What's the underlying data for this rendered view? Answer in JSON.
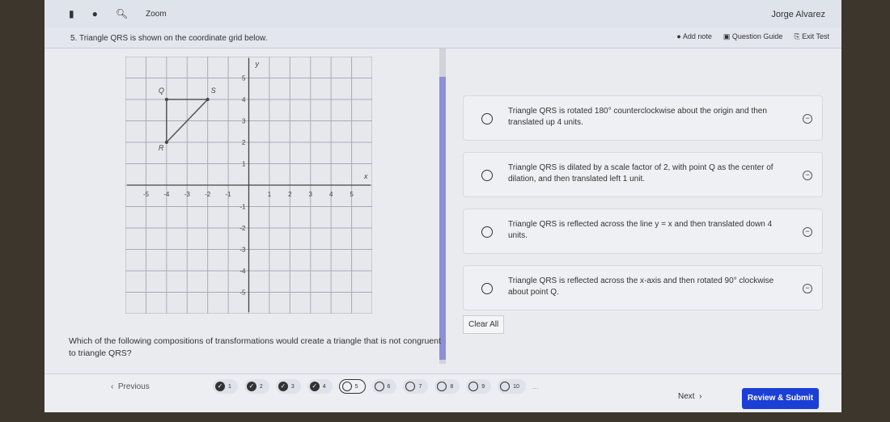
{
  "topbar": {
    "zoom_label": "Zoom",
    "user": "Jorge Alvarez"
  },
  "question": {
    "number": "5.",
    "title": "Triangle QRS is shown on the coordinate grid below.",
    "prompt": "Which of the following compositions of transformations would create a triangle that is not congruent to triangle QRS?"
  },
  "tools": {
    "add_note": "Add note",
    "question_guide": "Question Guide",
    "exit_test": "Exit Test"
  },
  "graph": {
    "x_label": "x",
    "y_label": "y",
    "range": [
      -6,
      6
    ],
    "tick_labels": [
      -5,
      -4,
      -3,
      -2,
      -1,
      1,
      2,
      3,
      4,
      5
    ],
    "points": [
      {
        "name": "Q",
        "x": -4,
        "y": 4
      },
      {
        "name": "R",
        "x": -4,
        "y": 2
      },
      {
        "name": "S",
        "x": -2,
        "y": 4
      }
    ]
  },
  "choices": [
    "Triangle QRS is rotated 180° counterclockwise about the origin and then translated up 4 units.",
    "Triangle QRS is dilated by a scale factor of 2, with point Q as the center of dilation, and then translated left 1 unit.",
    "Triangle QRS is reflected across the line y = x and then translated down 4 units.",
    "Triangle QRS is reflected across the x-axis and then rotated 90° clockwise about point Q."
  ],
  "clear_all": "Clear All",
  "nav": {
    "previous": "Previous",
    "next": "Next",
    "submit": "Review & Submit",
    "ellipsis": "...",
    "questions": [
      {
        "n": "1",
        "status": "answered"
      },
      {
        "n": "2",
        "status": "answered"
      },
      {
        "n": "3",
        "status": "answered"
      },
      {
        "n": "4",
        "status": "answered"
      },
      {
        "n": "5",
        "status": "current"
      },
      {
        "n": "6",
        "status": "unanswered"
      },
      {
        "n": "7",
        "status": "unanswered"
      },
      {
        "n": "8",
        "status": "unanswered"
      },
      {
        "n": "9",
        "status": "unanswered"
      },
      {
        "n": "10",
        "status": "unanswered"
      }
    ]
  },
  "colors": {
    "submit": "#1b3fd6",
    "scroll_thumb": "#8e8fd4"
  }
}
